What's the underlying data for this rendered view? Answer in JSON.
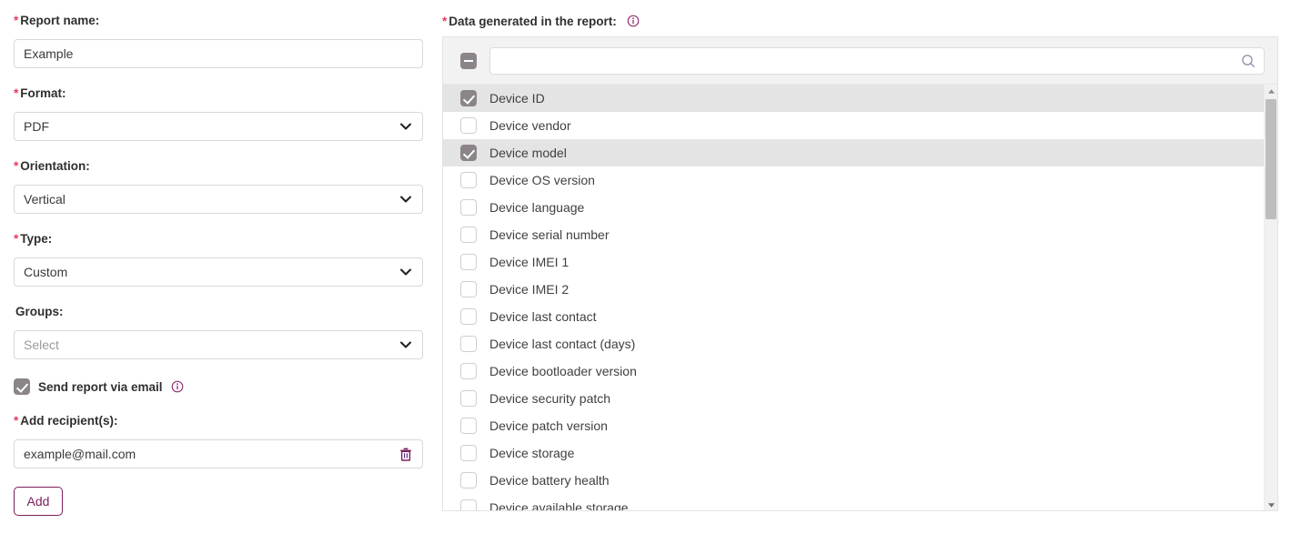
{
  "colors": {
    "required_star": "#e8395c",
    "accent_purple": "#7b1e5c",
    "checkbox_checked": "#8b8589",
    "selected_row": "#e4e4e4",
    "header_bg": "#f2f2f2",
    "border": "#d8d8d8"
  },
  "form": {
    "report_name": {
      "label": "Report name:",
      "required": "*",
      "value": "Example",
      "placeholder": ""
    },
    "format": {
      "label": "Format:",
      "required": "*",
      "value": "PDF"
    },
    "orientation": {
      "label": "Orientation:",
      "required": "*",
      "value": "Vertical"
    },
    "type": {
      "label": "Type:",
      "required": "*",
      "value": "Custom"
    },
    "groups": {
      "label": "Groups:",
      "required": "",
      "value": "Select",
      "is_placeholder": true
    },
    "send_email": {
      "label": "Send report via email",
      "checked": true
    },
    "recipients": {
      "label": "Add recipient(s):",
      "required": "*",
      "value": "example@mail.com",
      "placeholder": ""
    },
    "add_button": {
      "label": "Add"
    }
  },
  "data_panel": {
    "label": "Data generated in the report:",
    "required": "*",
    "search": {
      "value": "",
      "placeholder": ""
    },
    "select_all_state": "indeterminate",
    "options": [
      {
        "label": "Device ID",
        "checked": true
      },
      {
        "label": "Device vendor",
        "checked": false
      },
      {
        "label": "Device model",
        "checked": true
      },
      {
        "label": "Device OS version",
        "checked": false
      },
      {
        "label": "Device language",
        "checked": false
      },
      {
        "label": "Device serial number",
        "checked": false
      },
      {
        "label": "Device IMEI 1",
        "checked": false
      },
      {
        "label": "Device IMEI 2",
        "checked": false
      },
      {
        "label": "Device last contact",
        "checked": false
      },
      {
        "label": "Device last contact (days)",
        "checked": false
      },
      {
        "label": "Device bootloader version",
        "checked": false
      },
      {
        "label": "Device security patch",
        "checked": false
      },
      {
        "label": "Device patch version",
        "checked": false
      },
      {
        "label": "Device storage",
        "checked": false
      },
      {
        "label": "Device battery health",
        "checked": false
      },
      {
        "label": "Device available storage",
        "checked": false
      }
    ]
  }
}
